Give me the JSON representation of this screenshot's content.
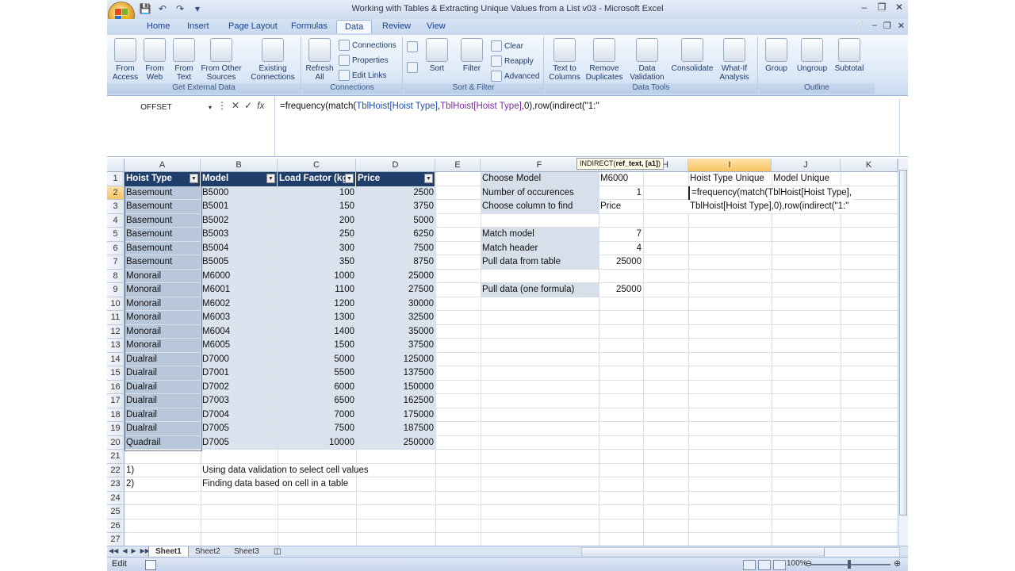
{
  "window": {
    "title": "Working with Tables & Extracting Unique Values from a List v03 - Microsoft Excel"
  },
  "ribbon_tabs": [
    "Home",
    "Insert",
    "Page Layout",
    "Formulas",
    "Data",
    "Review",
    "View"
  ],
  "active_tab": "Data",
  "ribbon": {
    "get_external_data": {
      "label": "Get External Data",
      "buttons": [
        "From\nAccess",
        "From\nWeb",
        "From\nText",
        "From Other\nSources",
        "Existing\nConnections"
      ]
    },
    "connections": {
      "label": "Connections",
      "refresh": "Refresh\nAll",
      "small": [
        "Connections",
        "Properties",
        "Edit Links"
      ]
    },
    "sort_filter": {
      "label": "Sort & Filter",
      "sort": "Sort",
      "filter": "Filter",
      "small": [
        "Clear",
        "Reapply",
        "Advanced"
      ]
    },
    "data_tools": {
      "label": "Data Tools",
      "buttons": [
        "Text to\nColumns",
        "Remove\nDuplicates",
        "Data\nValidation",
        "Consolidate",
        "What-If\nAnalysis"
      ]
    },
    "outline": {
      "label": "Outline",
      "buttons": [
        "Group",
        "Ungroup",
        "Subtotal"
      ]
    }
  },
  "formula_bar": {
    "name_box": "OFFSET",
    "formula_start": "=frequency(match(",
    "ref1": "TblHoist[Hoist Type]",
    "comma1": ",",
    "ref2": "TblHoist[Hoist Type]",
    "formula_end": ",0),row(indirect(\"1:\""
  },
  "tooltip": {
    "fn": "INDIRECT(",
    "args": "ref_text, [a1]",
    "close": ")"
  },
  "columns": [
    "A",
    "B",
    "C",
    "D",
    "E",
    "F",
    "G",
    "H",
    "I",
    "J",
    "K"
  ],
  "rows": [
    "1",
    "2",
    "3",
    "4",
    "5",
    "6",
    "7",
    "8",
    "9",
    "10",
    "11",
    "12",
    "13",
    "14",
    "15",
    "16",
    "17",
    "18",
    "19",
    "20",
    "21",
    "22",
    "23",
    "24",
    "25",
    "26",
    "27"
  ],
  "table": {
    "headers": [
      "Hoist Type",
      "Model",
      "Load Factor (kg)",
      "Price"
    ],
    "rows": [
      [
        "Basemount",
        "B5000",
        "100",
        "2500"
      ],
      [
        "Basemount",
        "B5001",
        "150",
        "3750"
      ],
      [
        "Basemount",
        "B5002",
        "200",
        "5000"
      ],
      [
        "Basemount",
        "B5003",
        "250",
        "6250"
      ],
      [
        "Basemount",
        "B5004",
        "300",
        "7500"
      ],
      [
        "Basemount",
        "B5005",
        "350",
        "8750"
      ],
      [
        "Monorail",
        "M6000",
        "1000",
        "25000"
      ],
      [
        "Monorail",
        "M6001",
        "1100",
        "27500"
      ],
      [
        "Monorail",
        "M6002",
        "1200",
        "30000"
      ],
      [
        "Monorail",
        "M6003",
        "1300",
        "32500"
      ],
      [
        "Monorail",
        "M6004",
        "1400",
        "35000"
      ],
      [
        "Monorail",
        "M6005",
        "1500",
        "37500"
      ],
      [
        "Dualrail",
        "D7000",
        "5000",
        "125000"
      ],
      [
        "Dualrail",
        "D7001",
        "5500",
        "137500"
      ],
      [
        "Dualrail",
        "D7002",
        "6000",
        "150000"
      ],
      [
        "Dualrail",
        "D7003",
        "6500",
        "162500"
      ],
      [
        "Dualrail",
        "D7004",
        "7000",
        "175000"
      ],
      [
        "Dualrail",
        "D7005",
        "7500",
        "187500"
      ],
      [
        "Quadrail",
        "D7005",
        "10000",
        "250000"
      ]
    ]
  },
  "lookup": {
    "choose_model_label": "Choose Model",
    "choose_model_value": "M6000",
    "occurrences_label": "Number of occurences",
    "occurrences_value": "1",
    "choose_column_label": "Choose column to find",
    "choose_column_value": "Price",
    "match_model_label": "Match model",
    "match_model_value": "7",
    "match_header_label": "Match header",
    "match_header_value": "4",
    "pull_label": "Pull data from table",
    "pull_value": "25000",
    "pull_one_label": "Pull data (one formula)",
    "pull_one_value": "25000"
  },
  "unique": {
    "hoist_header": "Hoist Type Unique",
    "model_header": "Model Unique",
    "edit_line1": "=frequency(match(TblHoist[Hoist Type],",
    "edit_line2": "TblHoist[Hoist Type],0),row(indirect(\"1:\""
  },
  "notes": {
    "n1": "1)",
    "t1": "Using data validation to select cell values",
    "n2": "2)",
    "t2": "Finding data based on cell in a table"
  },
  "sheets": [
    "Sheet1",
    "Sheet2",
    "Sheet3"
  ],
  "active_sheet": "Sheet1",
  "status": {
    "mode": "Edit",
    "zoom": "100%"
  }
}
